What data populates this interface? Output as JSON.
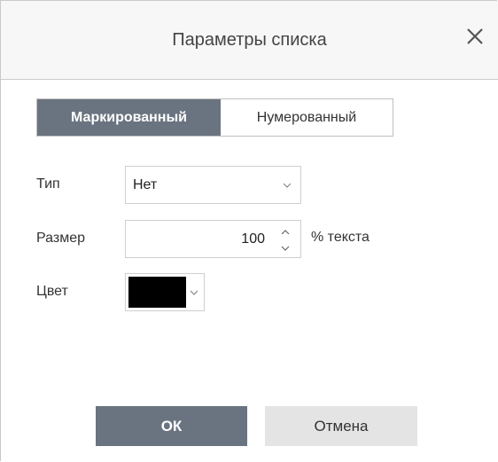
{
  "dialog": {
    "title": "Параметры списка",
    "close_icon": "close-icon"
  },
  "tabs": [
    {
      "label": "Маркированный",
      "active": true
    },
    {
      "label": "Нумерованный",
      "active": false
    }
  ],
  "fields": {
    "type_label": "Тип",
    "type_value": "Нет",
    "size_label": "Размер",
    "size_value": "100",
    "size_unit": "% текста",
    "color_label": "Цвет",
    "color_value": "#000000"
  },
  "buttons": {
    "ok": "ОК",
    "cancel": "Отмена"
  },
  "colors": {
    "accent": "#6a7480",
    "header_bg": "#f7f7f7",
    "cancel_bg": "#e4e4e4"
  }
}
